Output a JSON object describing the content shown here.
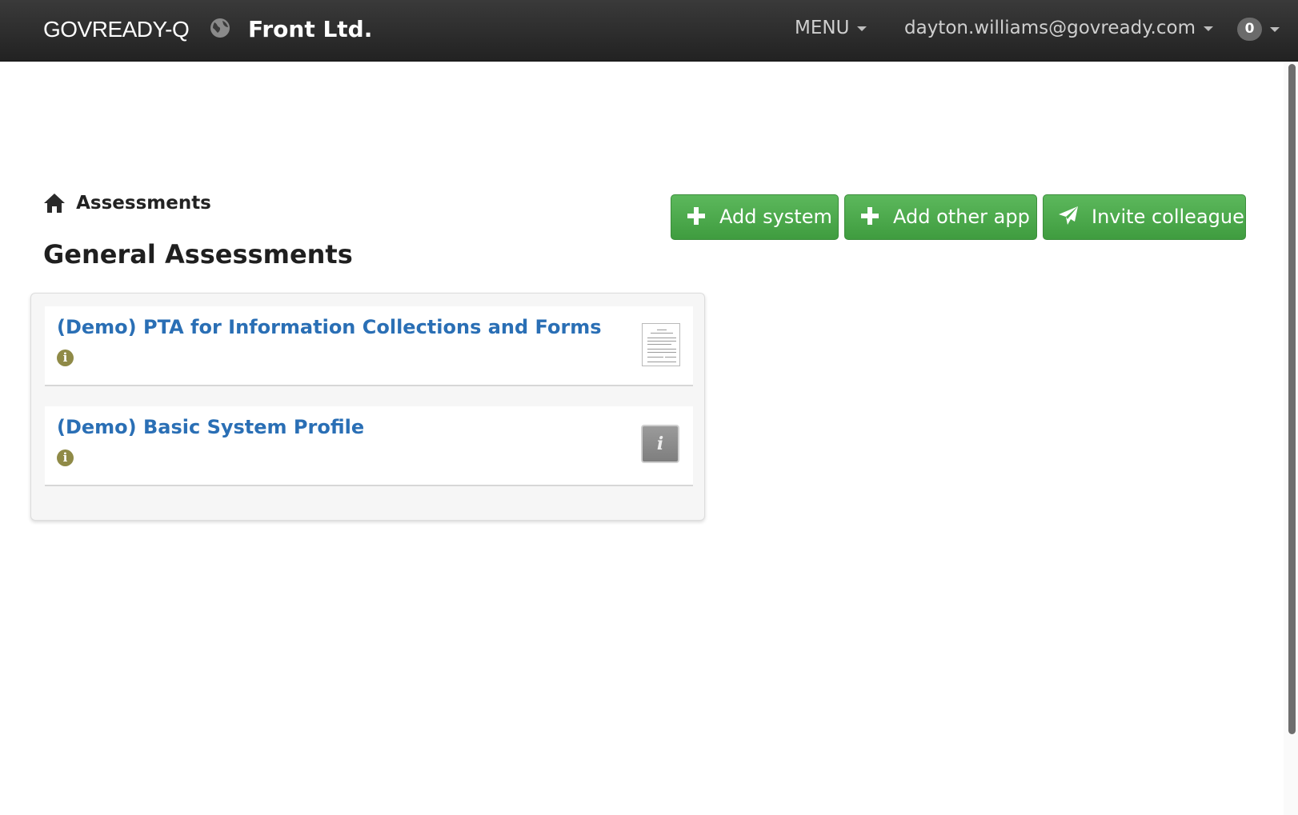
{
  "navbar": {
    "brand": "GOVREADY-Q",
    "org_name": "Front Ltd.",
    "menu_label": "MENU",
    "user_email": "dayton.williams@govready.com",
    "notification_count": "0"
  },
  "breadcrumb": {
    "label": "Assessments"
  },
  "page": {
    "title": "General Assessments"
  },
  "actions": {
    "add_system": "Add system",
    "add_other_app": "Add other app",
    "invite_colleague": "Invite colleague"
  },
  "assessments": [
    {
      "title": "(Demo) PTA for Information Collections and Forms",
      "thumbnail": "document-thumbnail"
    },
    {
      "title": "(Demo) Basic System Profile",
      "thumbnail": "info-tile-icon",
      "tile_glyph": "i"
    }
  ],
  "icons": {
    "info_glyph": "i"
  },
  "colors": {
    "navbar": "#2b2b2b",
    "button_green": "#4cae4c",
    "link_blue": "#2a6fb5",
    "info_olive": "#8f8a47"
  }
}
